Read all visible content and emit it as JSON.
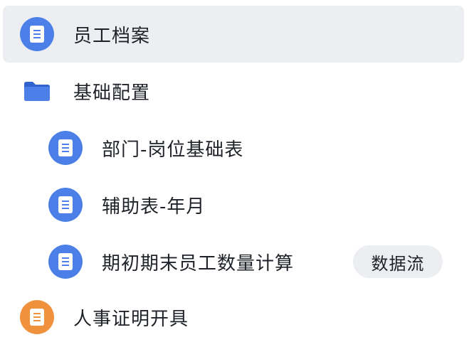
{
  "tree": {
    "items": [
      {
        "label": "员工档案",
        "icon": "document-icon",
        "icon_color": "#4c80e8",
        "selected": true
      },
      {
        "label": "基础配置",
        "icon": "folder-icon",
        "icon_color": "#3f78e4",
        "expanded": true
      },
      {
        "label": "部门-岗位基础表",
        "icon": "document-icon",
        "icon_color": "#4c80e8"
      },
      {
        "label": "辅助表-年月",
        "icon": "document-icon",
        "icon_color": "#4c80e8"
      },
      {
        "label": "期初期末员工数量计算",
        "icon": "document-icon",
        "icon_color": "#4c80e8",
        "badge": "数据流"
      },
      {
        "label": "人事证明开具",
        "icon": "document-icon",
        "icon_color": "#f0913e"
      }
    ]
  },
  "colors": {
    "selected_background": "#eceef2",
    "badge_background": "#eceef2",
    "text": "#1f2329"
  }
}
